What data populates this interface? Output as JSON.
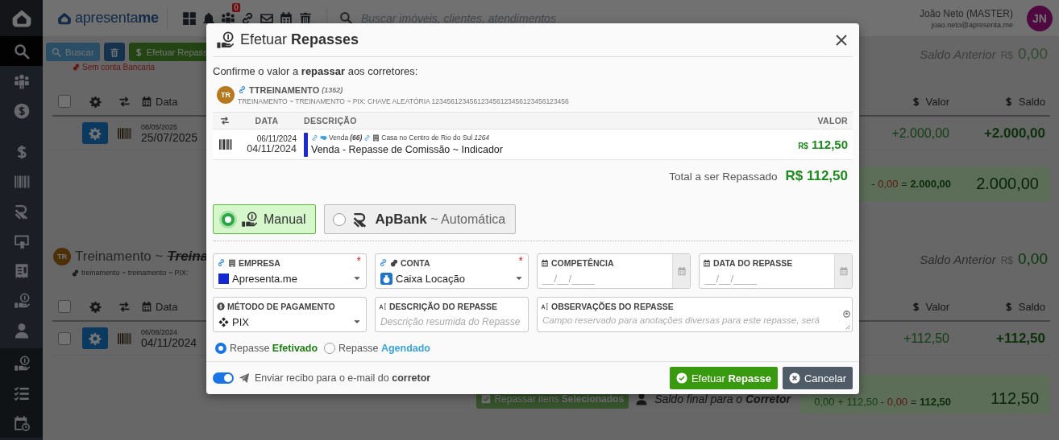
{
  "sidebar": {
    "items": [
      {
        "kind": "search",
        "selected": true
      },
      {
        "kind": "team",
        "selected": false
      },
      {
        "kind": "money",
        "selected": false
      },
      {
        "kind": "dollar",
        "selected": false
      },
      {
        "kind": "barcode",
        "selected": false
      },
      {
        "kind": "stripes",
        "selected": false
      },
      {
        "kind": "certificate",
        "selected": false
      },
      {
        "kind": "receipt",
        "selected": false
      },
      {
        "kind": "payout",
        "selected": false
      },
      {
        "kind": "user",
        "selected": false
      }
    ],
    "bottom_items": [
      {
        "kind": "payout",
        "selected": false
      },
      {
        "kind": "checklist",
        "selected": false
      },
      {
        "kind": "schedule",
        "selected": false
      }
    ]
  },
  "header": {
    "logo": "apresenta**me**",
    "tools": [
      {
        "kind": "grid"
      },
      {
        "kind": "bell"
      },
      {
        "kind": "team",
        "badge": "0"
      },
      {
        "kind": "link"
      },
      {
        "kind": "mail"
      },
      {
        "kind": "calendar"
      },
      {
        "kind": "trash"
      }
    ],
    "search": {
      "placeholder": "Buscar imóveis, clientes, atendimentos"
    },
    "user": {
      "name": "João Neto (MASTER)",
      "email": "joao.neto@apresenta.me",
      "initials": "JN"
    }
  },
  "content": {
    "actions": {
      "buttons": [
        {
          "kind": "search",
          "label": "Buscar"
        },
        {
          "kind": "trash"
        },
        {
          "kind": "payout",
          "label": "Efetuar Repass"
        }
      ],
      "warning": "Sem conta Bancaria"
    },
    "sections": [
      {
        "saldo_anterior": {
          "label": "Saldo Anterior",
          "currency": "R$",
          "value": "0,00",
          "muted": true
        },
        "select_all": false,
        "columns": {
          "date": "Data",
          "valor": "Valor",
          "saldo": "Saldo"
        },
        "rows": [
          {
            "date_small": "08/05/2025",
            "date": "25/07/2025",
            "valor": "+2.000,00",
            "saldo": "+2.000,00"
          }
        ],
        "summary": {
          "expression": [
            {
              "kind": "op",
              "text": "-"
            },
            {
              "kind": "debit",
              "text": "0,00"
            },
            {
              "kind": "op",
              "text": "="
            },
            {
              "kind": "result",
              "text": "2.000,00"
            }
          ],
          "total": "2.000,00"
        }
      },
      {
        "avatar": "TR",
        "title": "Treinamento ~",
        "alias": "Treina",
        "subtitle": "treinamento ~ treinamento ~ PIX:",
        "saldo_anterior": {
          "label": "Saldo Anterior",
          "currency": "R$",
          "value": "0,00",
          "muted": false
        },
        "select_all": false,
        "columns": {
          "date": "Data",
          "valor": "Valor",
          "saldo": "Saldo"
        },
        "rows": [
          {
            "checked": false,
            "date_small": "06/08/2024",
            "date": "04/11/2024",
            "valor": "+112,50",
            "saldo": "+112,50"
          }
        ],
        "summary": {
          "button": {
            "label": "Repassar itens **Selecionados**",
            "disabled": true
          },
          "caption": "Saldo final para o **Corretor**",
          "expression": [
            {
              "kind": "credit",
              "text": "0,00"
            },
            {
              "kind": "credit",
              "text": "+"
            },
            {
              "kind": "credit",
              "text": "112,50"
            },
            {
              "kind": "op",
              "text": "-"
            },
            {
              "kind": "debit",
              "text": "0,00"
            },
            {
              "kind": "op",
              "text": "="
            },
            {
              "kind": "result",
              "text": "112,50"
            }
          ],
          "total": "112,50"
        }
      }
    ]
  },
  "modal": {
    "title": "Efetuar **Repasses**",
    "prompt": "Confirme o valor a **repassar** aos corretores:",
    "broker": {
      "initials": "TR",
      "name": "TTREINAMENTO",
      "code": "(1352)",
      "details": "TREINAMENTO ~ TREINAMENTO ~ PIX: CHAVE ALEATÓRIA 123456123456123456123456123456123456"
    },
    "table": {
      "columns": {
        "date": "DATA",
        "description": "DESCRIÇÃO",
        "value": "VALOR"
      },
      "rows": [
        {
          "date_small": "06/11/2024",
          "date": "04/11/2024",
          "color": "#1a2bd4",
          "deal": "Venda",
          "deal_code": "(66)",
          "property": "Casa no Centro de Rio do Sul",
          "property_code": "1264",
          "description": "Venda - Repasse de Comissão ~ Indicador",
          "currency": "R$",
          "value": "112,50"
        }
      ]
    },
    "total": {
      "label": "Total a ser Repassado",
      "value": "R$ 112,50"
    },
    "modes": [
      {
        "kind": "manual",
        "label": "Manual",
        "selected": true
      },
      {
        "kind": "apbank",
        "label": "**ApBank** ~ Automática",
        "selected": false
      }
    ],
    "fields": [
      {
        "kind": "company",
        "label": "EMPRESA",
        "linked": true,
        "required_mark": "*",
        "value": "Apresenta.me",
        "color": "#1428d2"
      },
      {
        "kind": "account",
        "label": "CONTA",
        "linked": true,
        "required_mark": "*",
        "value": "Caixa Locação"
      },
      {
        "kind": "date",
        "label": "COMPETÊNCIA",
        "placeholder": "__/__/____"
      },
      {
        "kind": "date",
        "label": "DATA DO REPASSE",
        "placeholder": "__/__/____"
      },
      {
        "kind": "method",
        "label": "MÉTODO DE PAGAMENTO",
        "value": "PIX"
      },
      {
        "kind": "text",
        "label": "DESCRIÇÃO DO REPASSE",
        "placeholder": "Descrição resumida do Repasse"
      },
      {
        "kind": "textarea",
        "label": "OBSERVAÇÕES DO REPASSE",
        "placeholder": "Campo reservado para anotações diversas para este repasse, será"
      }
    ],
    "status_options": [
      {
        "kind": "done",
        "label": "Repasse **Efetivado**",
        "selected": true
      },
      {
        "kind": "scheduled",
        "label": "Repasse **Agendado**",
        "selected": false
      }
    ],
    "email_receipt": {
      "on": true,
      "label": "Enviar recibo para o e-mail do **corretor**"
    },
    "buttons": [
      {
        "kind": "confirm",
        "label": "Efetuar **Repasse**"
      },
      {
        "kind": "cancel",
        "label": "Cancelar"
      }
    ]
  }
}
